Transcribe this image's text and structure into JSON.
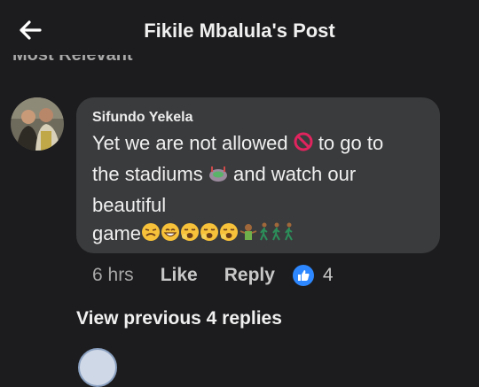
{
  "header": {
    "title": "Fikile Mbalula's Post"
  },
  "sort": {
    "label": "Most Relevant"
  },
  "comment": {
    "author": "Sifundo Yekela",
    "line1_a": "Yet we are not allowed",
    "line1_b": "to go to",
    "line2_a": "the stadiums",
    "line2_b": "and watch our",
    "line3": "beautiful",
    "line4": "game",
    "time": "6 hrs",
    "like_label": "Like",
    "reply_label": "Reply",
    "like_count": "4"
  },
  "replies": {
    "view_previous": "View previous 4 replies"
  },
  "colors": {
    "like_blue": "#2d88ff",
    "prohibited_red": "#e0245e",
    "bubble": "#3a3b3d"
  }
}
